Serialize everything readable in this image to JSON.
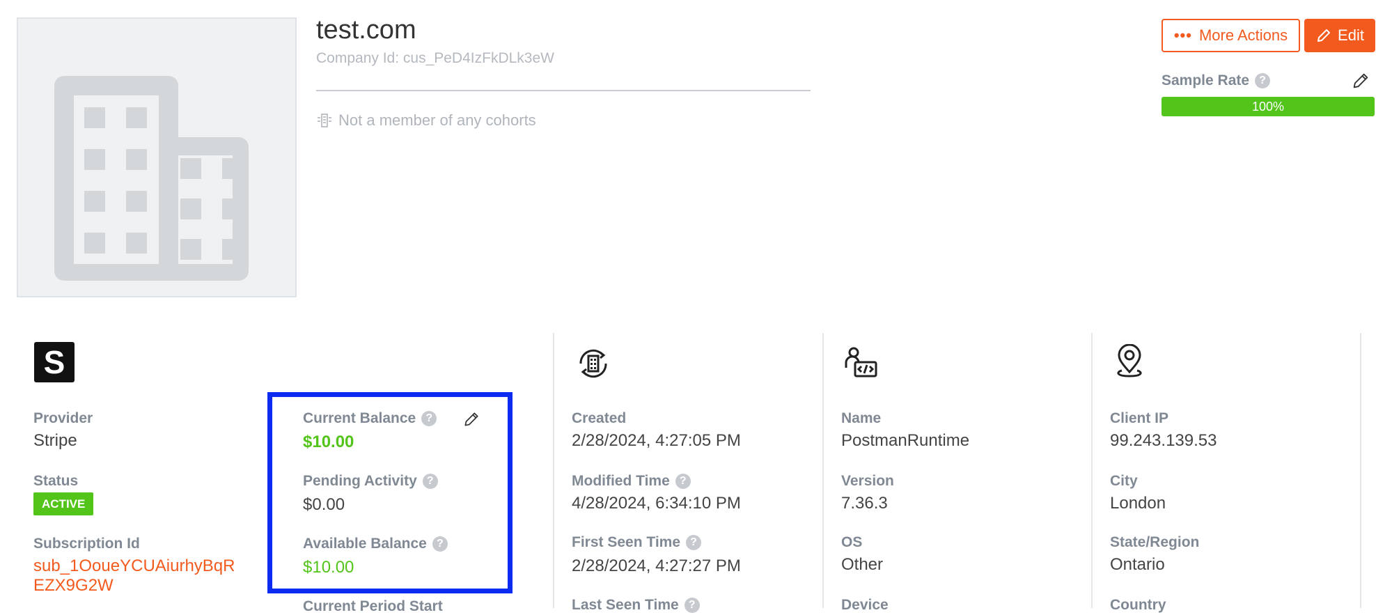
{
  "header": {
    "title": "test.com",
    "company_id": "Company Id: cus_PeD4IzFkDLk3eW",
    "cohort_text": "Not a member of any cohorts",
    "more_actions_label": "More Actions",
    "edit_label": "Edit"
  },
  "sample_rate": {
    "label": "Sample Rate",
    "value_text": "100%",
    "value": 100
  },
  "billing": {
    "provider_label": "Provider",
    "provider_value": "Stripe",
    "status_label": "Status",
    "status_value": "ACTIVE",
    "subscription_label": "Subscription Id",
    "subscription_value_line1": "sub_1OoueYCUAiurhyBqR",
    "subscription_value_line2": "EZX9G2W",
    "current_balance_label": "Current Balance",
    "current_balance_value": "$10.00",
    "pending_label": "Pending Activity",
    "pending_value": "$0.00",
    "available_label": "Available Balance",
    "available_value": "$10.00",
    "period_start_label": "Current Period Start"
  },
  "times": {
    "created_label": "Created",
    "created_value": "2/28/2024, 4:27:05 PM",
    "modified_label": "Modified Time",
    "modified_value": "4/28/2024, 6:34:10 PM",
    "first_seen_label": "First Seen Time",
    "first_seen_value": "2/28/2024, 4:27:27 PM",
    "last_seen_label": "Last Seen Time"
  },
  "agent": {
    "name_label": "Name",
    "name_value": "PostmanRuntime",
    "version_label": "Version",
    "version_value": "7.36.3",
    "os_label": "OS",
    "os_value": "Other",
    "device_label": "Device"
  },
  "location": {
    "ip_label": "Client IP",
    "ip_value": "99.243.139.53",
    "city_label": "City",
    "city_value": "London",
    "region_label": "State/Region",
    "region_value": "Ontario",
    "country_label": "Country"
  },
  "colors": {
    "accent": "#f25a1e",
    "success": "#52c41a",
    "highlight": "#0b2cf0"
  },
  "icons": {
    "company": "building-icon",
    "provider": "stripe-logo",
    "created": "building-history-icon",
    "agent": "user-code-icon",
    "location": "location-pin-icon"
  }
}
